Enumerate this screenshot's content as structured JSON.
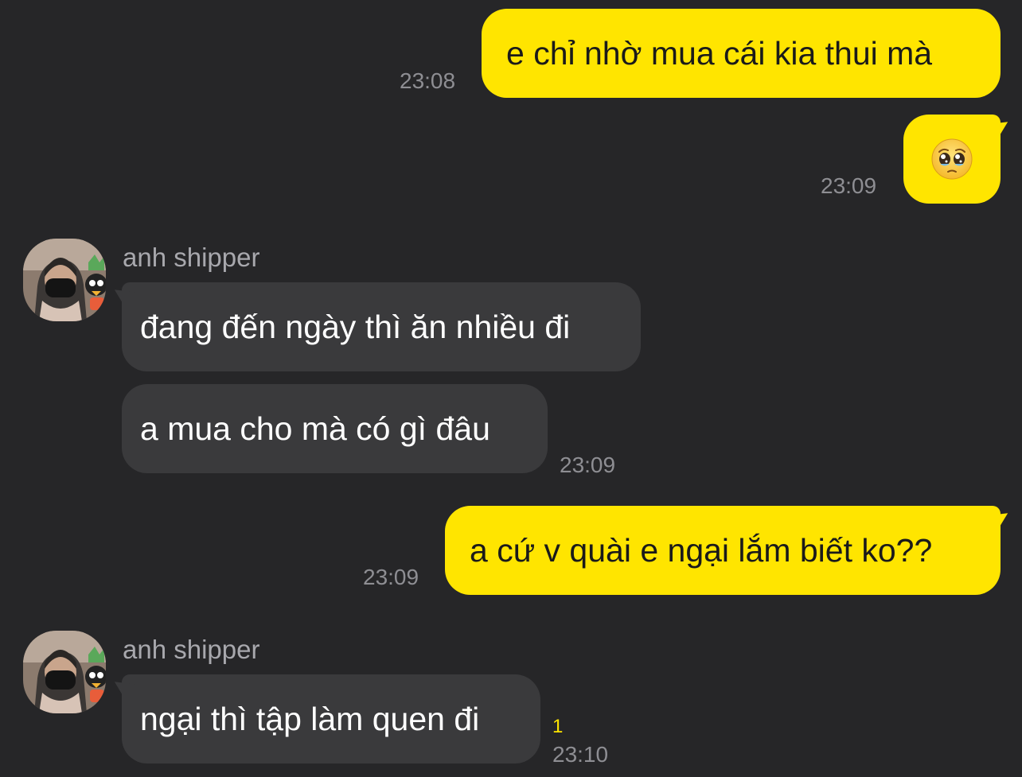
{
  "chat": {
    "messages": [
      {
        "id": "m1",
        "direction": "out",
        "text": "e chỉ nhờ mua cái kia thui mà",
        "time": "23:08"
      },
      {
        "id": "m2",
        "direction": "out",
        "text": "",
        "emoji": "pleading-face",
        "time": "23:09"
      },
      {
        "id": "m3",
        "direction": "in",
        "sender": "anh shipper",
        "text": "đang đến ngày thì ăn nhiều đi"
      },
      {
        "id": "m4",
        "direction": "in",
        "text": "a mua cho mà có gì đâu",
        "time": "23:09"
      },
      {
        "id": "m5",
        "direction": "out",
        "text": "a cứ v quài e ngại lắm biết ko??",
        "time": "23:09"
      },
      {
        "id": "m6",
        "direction": "in",
        "sender": "anh shipper",
        "text": "ngại thì tập làm quen đi",
        "time": "23:10",
        "unread_count": "1"
      }
    ]
  },
  "colors": {
    "background": "#262628",
    "outgoing_bubble": "#FFE500",
    "incoming_bubble": "#3a3a3c",
    "timestamp": "#8e8e93",
    "unread": "#FFE500"
  }
}
